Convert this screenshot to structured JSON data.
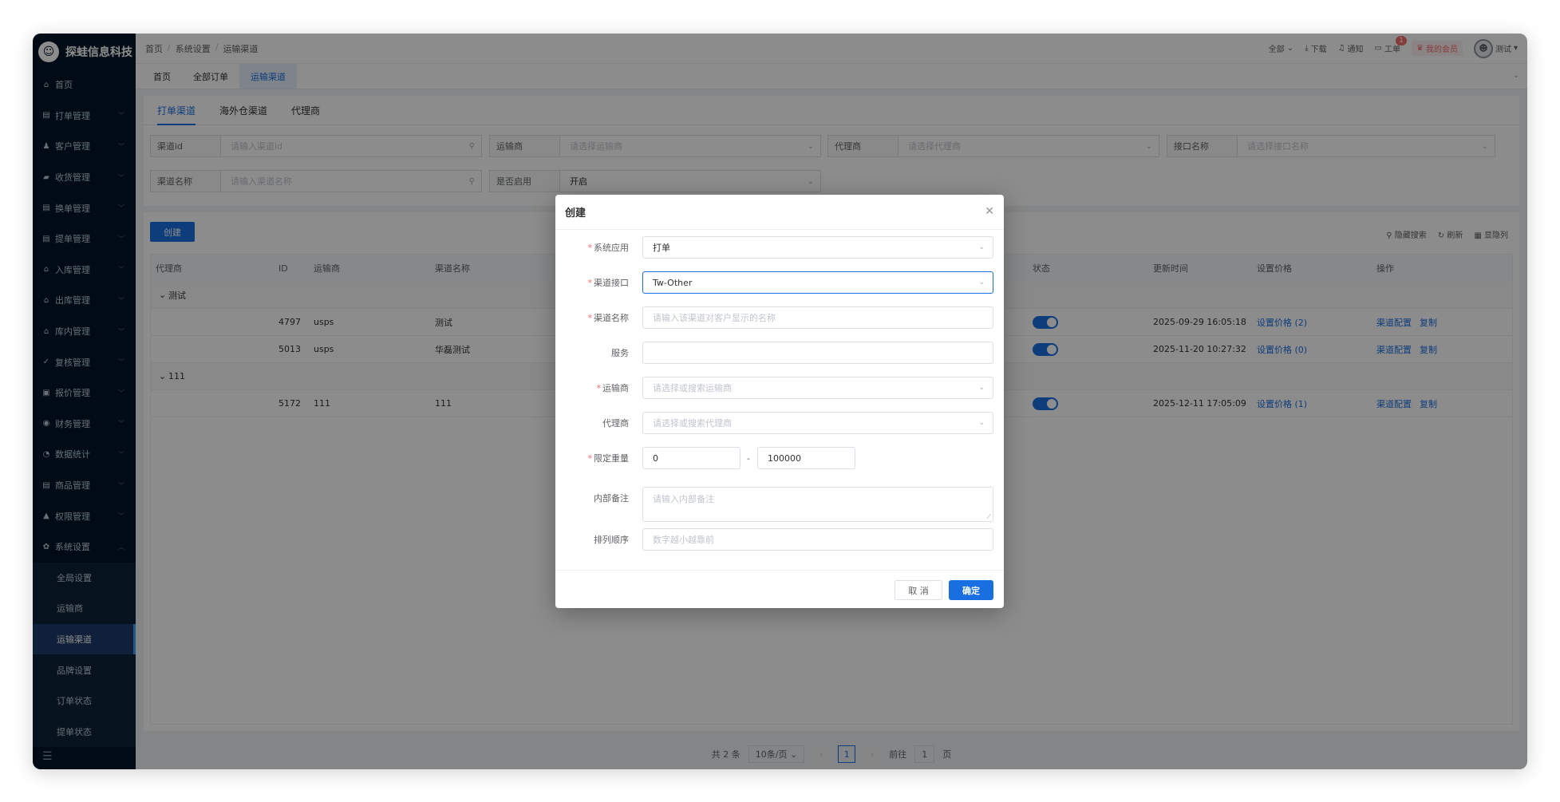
{
  "app": {
    "brand": "探蛙信息科技"
  },
  "sidebar": {
    "items": [
      {
        "label": "首页",
        "icon": "home-icon"
      },
      {
        "label": "打单管理",
        "icon": "document-icon"
      },
      {
        "label": "客户管理",
        "icon": "user-icon"
      },
      {
        "label": "收货管理",
        "icon": "truck-icon"
      },
      {
        "label": "换单管理",
        "icon": "document-icon"
      },
      {
        "label": "提单管理",
        "icon": "document-icon"
      },
      {
        "label": "入库管理",
        "icon": "warehouse-icon"
      },
      {
        "label": "出库管理",
        "icon": "warehouse-icon"
      },
      {
        "label": "库内管理",
        "icon": "shop-icon"
      },
      {
        "label": "复核管理",
        "icon": "check-icon"
      },
      {
        "label": "报价管理",
        "icon": "price-icon"
      },
      {
        "label": "财务管理",
        "icon": "finance-icon"
      },
      {
        "label": "数据统计",
        "icon": "pie-chart-icon"
      },
      {
        "label": "商品管理",
        "icon": "goods-icon"
      },
      {
        "label": "权限管理",
        "icon": "lock-icon"
      },
      {
        "label": "系统设置",
        "icon": "gear-icon"
      }
    ],
    "sub_items": [
      "全局设置",
      "运输商",
      "运输渠道",
      "品牌设置",
      "订单状态",
      "提单状态"
    ]
  },
  "topbar": {
    "breadcrumb": [
      "首页",
      "系统设置",
      "运输渠道"
    ],
    "scope": "全部",
    "download": "下载",
    "notify": "通知",
    "ticket": "工单",
    "ticket_badge": "1",
    "vip": "我的会员",
    "user": "测试"
  },
  "page_tabs": [
    "首页",
    "全部订单",
    "运输渠道"
  ],
  "inner_tabs": [
    "打单渠道",
    "海外仓渠道",
    "代理商"
  ],
  "filters": [
    {
      "label": "渠道id",
      "placeholder": "请输入渠道id"
    },
    {
      "label": "运输商",
      "placeholder": "请选择运输商"
    },
    {
      "label": "代理商",
      "placeholder": "请选择代理商"
    },
    {
      "label": "接口名称",
      "placeholder": "请选择接口名称"
    },
    {
      "label": "渠道名称",
      "placeholder": "请输入渠道名称"
    },
    {
      "label": "是否启用",
      "value": "开启"
    }
  ],
  "actions": {
    "create": "创建",
    "hide_search": "隐藏搜索",
    "refresh": "刷新",
    "show_columns": "显隐列"
  },
  "table": {
    "headers": [
      "代理商",
      "ID",
      "运输商",
      "渠道名称",
      "状态",
      "更新时间",
      "设置价格",
      "操作"
    ],
    "groups": [
      {
        "name": "测试",
        "rows": [
          {
            "id": "4797",
            "carrier": "usps",
            "name": "测试",
            "updated": "2025-09-29 16:05:18",
            "price": "设置价格 (2)"
          },
          {
            "id": "5013",
            "carrier": "usps",
            "name": "华磊测试",
            "updated": "2025-11-20 10:27:32",
            "price": "设置价格 (0)"
          }
        ]
      },
      {
        "name": "111",
        "rows": [
          {
            "id": "5172",
            "carrier": "111",
            "name": "111",
            "updated": "2025-12-11 17:05:09",
            "price": "设置价格 (1)"
          }
        ]
      }
    ],
    "op_config": "渠道配置",
    "op_copy": "复制"
  },
  "pager": {
    "total": "共 2 条",
    "size": "10条/页",
    "page": "1",
    "goto": "前往",
    "goto_val": "1",
    "unit": "页"
  },
  "dialog": {
    "title": "创建",
    "fields": {
      "app": {
        "label": "系统应用",
        "value": "打单"
      },
      "api": {
        "label": "渠道接口",
        "value": "Tw-Other"
      },
      "name": {
        "label": "渠道名称",
        "placeholder": "请输入该渠道对客户显示的名称"
      },
      "service": {
        "label": "服务",
        "value": ""
      },
      "carrier": {
        "label": "运输商",
        "placeholder": "请选择或搜索运输商"
      },
      "agent": {
        "label": "代理商",
        "placeholder": "请选择或搜索代理商"
      },
      "weight": {
        "label": "限定重量",
        "min": "0",
        "sep": "-",
        "max": "100000"
      },
      "remark": {
        "label": "内部备注",
        "placeholder": "请输入内部备注"
      },
      "order": {
        "label": "排列顺序",
        "placeholder": "数字越小越靠前"
      }
    },
    "cancel": "取 消",
    "ok": "确定"
  }
}
